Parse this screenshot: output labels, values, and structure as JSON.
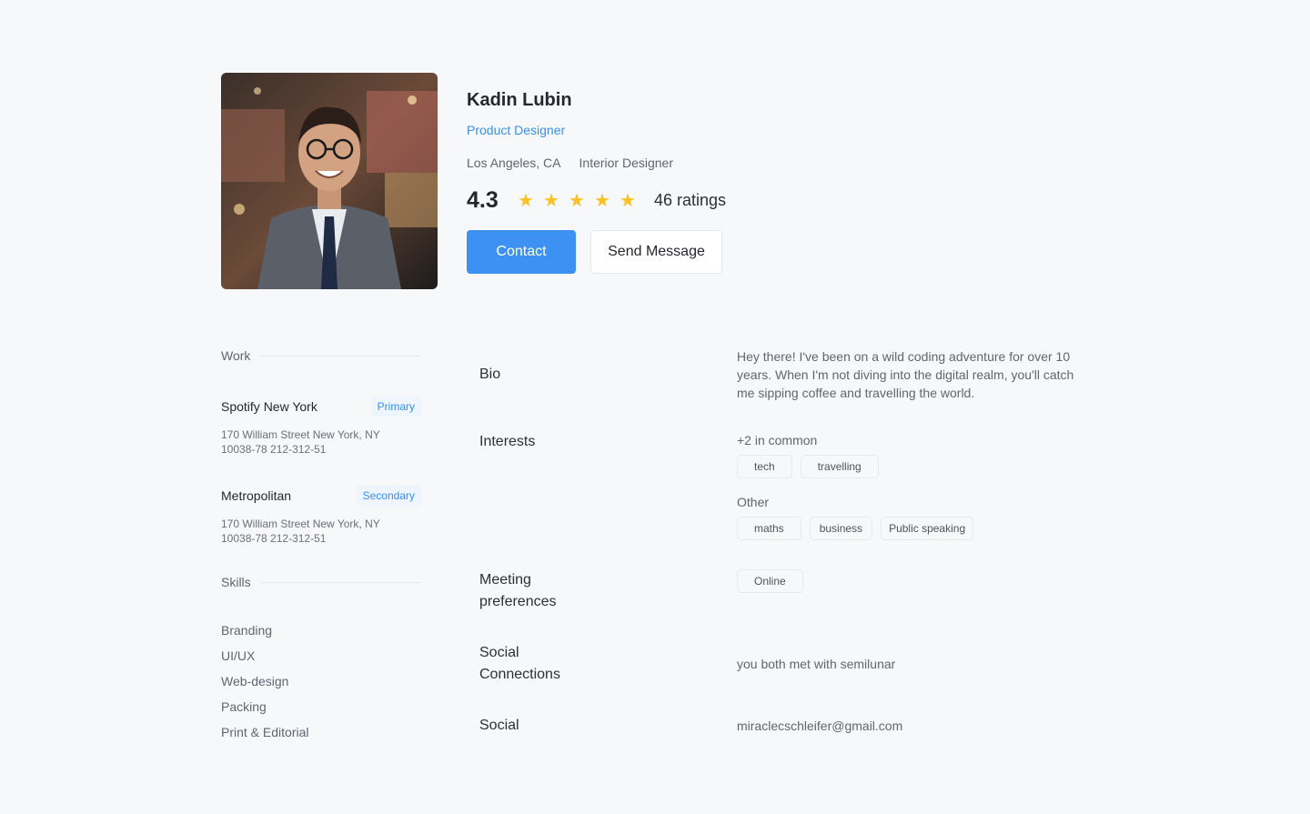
{
  "profile": {
    "name": "Kadin Lubin",
    "role": "Product Designer",
    "location": "Los Angeles, CA",
    "secondary_role": "Interior Designer",
    "rating": "4.3",
    "stars": 5,
    "ratings_label": "46 ratings",
    "contact_label": "Contact",
    "message_label": "Send Message"
  },
  "work": {
    "title": "Work",
    "items": [
      {
        "company": "Spotify New York",
        "badge": "Primary",
        "address": "170 William Street New York, NY 10038-78 212-312-51"
      },
      {
        "company": "Metropolitan",
        "badge": "Secondary",
        "address": "170 William Street New York, NY 10038-78 212-312-51"
      }
    ]
  },
  "skills": {
    "title": "Skills",
    "items": [
      "Branding",
      "UI/UX",
      "Web-design",
      "Packing",
      "Print & Editorial"
    ]
  },
  "details": {
    "bio_label": "Bio",
    "bio_text": "Hey there! I've been on a wild coding adventure for over 10 years. When I'm not diving into the digital realm, you'll catch me sipping coffee and travelling the world.",
    "interests_label": "Interests",
    "common_label": "+2 in common",
    "common_tags": [
      "tech",
      "travelling"
    ],
    "other_label": "Other",
    "other_tags": [
      "maths",
      "business",
      "Public speaking"
    ],
    "meeting_label": "Meeting preferences",
    "meeting_tags": [
      "Online"
    ],
    "social_connections_label": "Social Connections",
    "social_connections_text": "you both met with semilunar",
    "social_label": "Social",
    "social_text": "miraclecschleifer@gmail.com"
  },
  "colors": {
    "accent": "#3d91f3",
    "star": "#f7c325",
    "background": "#f6f8fa"
  }
}
